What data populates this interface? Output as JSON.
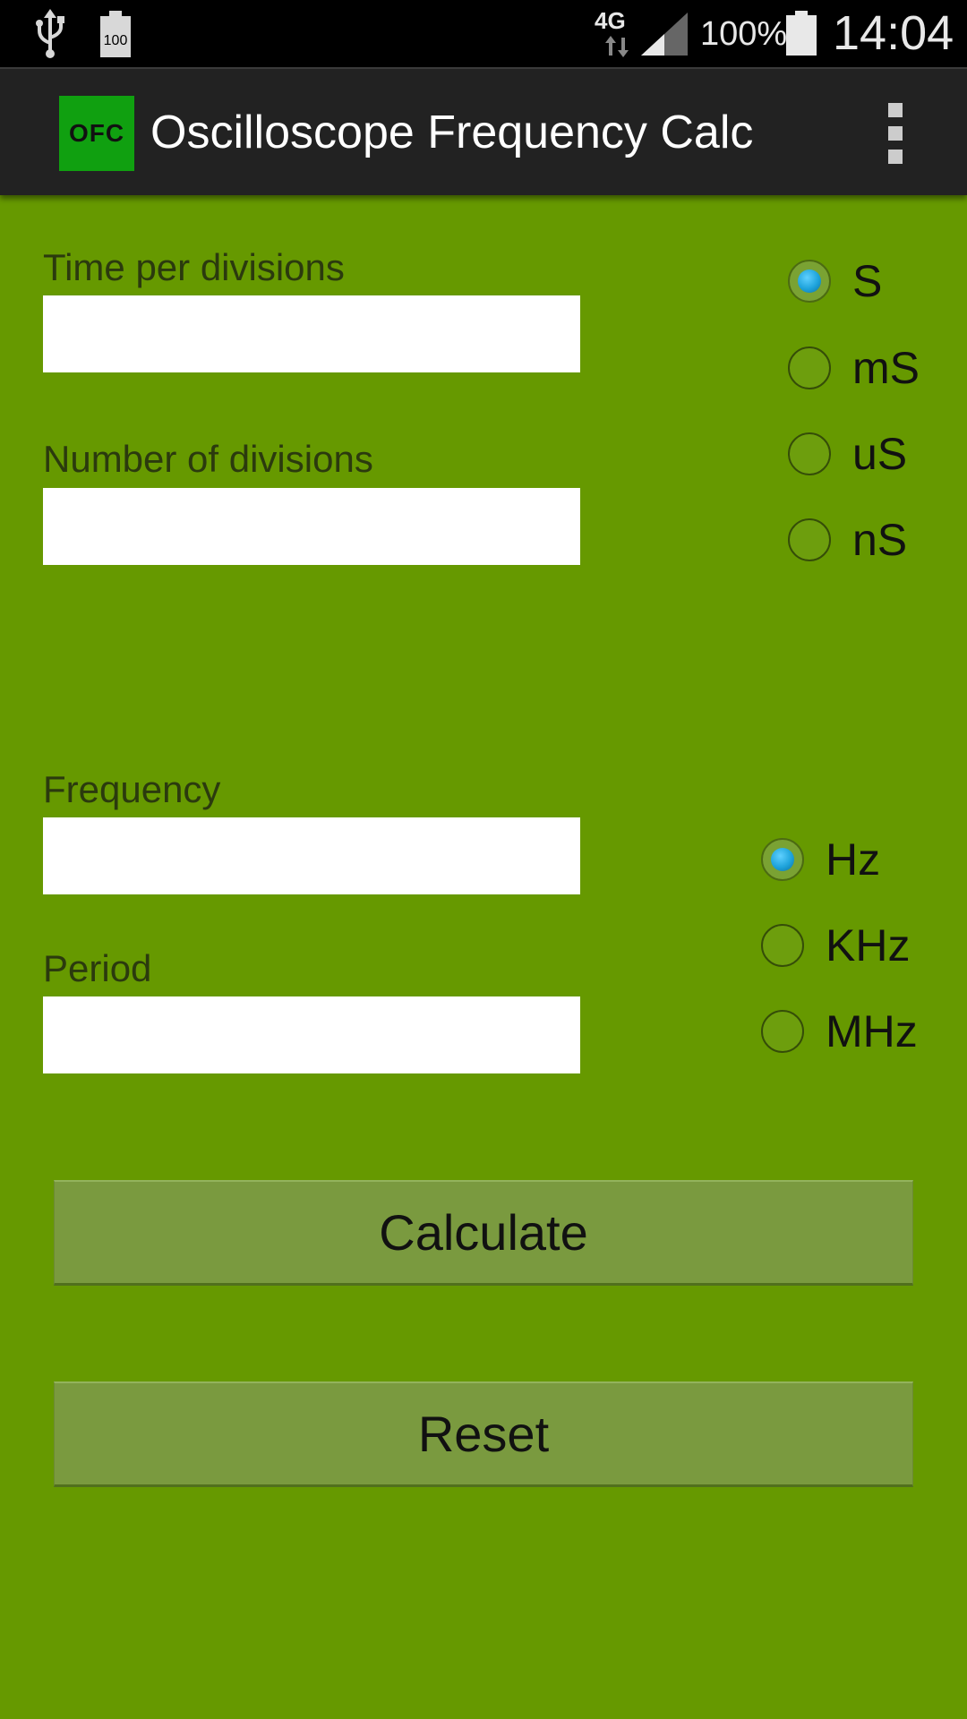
{
  "status_bar": {
    "battery_small_label": "100",
    "network": "4G",
    "battery_percent": "100%",
    "time": "14:04"
  },
  "action_bar": {
    "logo_text": "OFC",
    "title": "Oscilloscope Frequency Calc"
  },
  "form": {
    "time_per_div": {
      "label": "Time per divisions",
      "value": ""
    },
    "num_divs": {
      "label": "Number of divisions",
      "value": ""
    },
    "frequency": {
      "label": "Frequency",
      "value": ""
    },
    "period": {
      "label": "Period",
      "value": ""
    }
  },
  "time_units": [
    {
      "label": "S",
      "checked": true
    },
    {
      "label": "mS",
      "checked": false
    },
    {
      "label": "uS",
      "checked": false
    },
    {
      "label": "nS",
      "checked": false
    }
  ],
  "freq_units": [
    {
      "label": "Hz",
      "checked": true
    },
    {
      "label": "KHz",
      "checked": false
    },
    {
      "label": "MHz",
      "checked": false
    }
  ],
  "buttons": {
    "calculate": "Calculate",
    "reset": "Reset"
  },
  "colors": {
    "background": "#669900",
    "action_bar": "#222222",
    "logo": "#10a010",
    "button": "#7a9a3f",
    "radio_selected": "#1ea3db"
  }
}
